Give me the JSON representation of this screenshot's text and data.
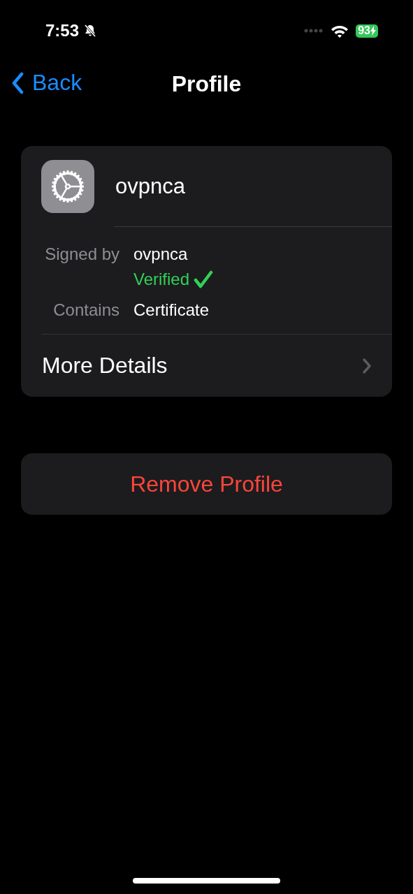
{
  "status_bar": {
    "time": "7:53",
    "silent": true,
    "battery": "93",
    "charging": true
  },
  "nav": {
    "back": "Back",
    "title": "Profile"
  },
  "profile": {
    "name": "ovpnca",
    "details": [
      {
        "label": "Signed by",
        "value": "ovpnca",
        "verified": true,
        "verified_text": "Verified"
      },
      {
        "label": "Contains",
        "value": "Certificate",
        "verified": false
      }
    ],
    "more": "More Details"
  },
  "remove_button": "Remove Profile"
}
